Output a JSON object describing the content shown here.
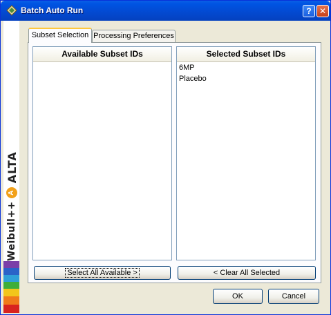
{
  "window": {
    "title": "Batch Auto Run",
    "help_label": "?",
    "close_label": "✕"
  },
  "sidebar": {
    "brand_weibull": "Weibull++",
    "brand_alta": "ALTA",
    "w_logo": "W",
    "a_logo": "A"
  },
  "tabs": [
    {
      "label": "Subset Selection",
      "active": true
    },
    {
      "label": "Processing Preferences",
      "active": false
    }
  ],
  "available": {
    "header": "Available Subset IDs",
    "items": []
  },
  "selected": {
    "header": "Selected Subset IDs",
    "items": [
      "6MP",
      "Placebo"
    ]
  },
  "buttons": {
    "select_all": "Select All Available >",
    "clear_all": "< Clear All Selected",
    "ok": "OK",
    "cancel": "Cancel"
  },
  "colors": {
    "titlebar": "#0054e3",
    "window_bg": "#ece9d8",
    "tab_highlight": "#ffc83c"
  }
}
